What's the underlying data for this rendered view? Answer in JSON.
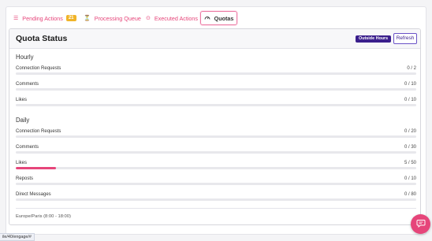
{
  "tabs": [
    {
      "label": "Pending Actions",
      "badge": "21",
      "icon": "list-icon"
    },
    {
      "label": "Processing Queue",
      "icon": "hourglass-icon"
    },
    {
      "label": "Executed Actions",
      "icon": "check-circle-icon"
    },
    {
      "label": "Quotas",
      "icon": "gauge-icon",
      "active": true
    }
  ],
  "panel": {
    "title": "Quota Status",
    "status_badge": "Outside Hours",
    "refresh_label": "Refresh"
  },
  "hourly": {
    "title": "Hourly",
    "rows": [
      {
        "label": "Connection Requests",
        "count": "0 / 2",
        "used": 0,
        "limit": 2
      },
      {
        "label": "Comments",
        "count": "0 / 10",
        "used": 0,
        "limit": 10
      },
      {
        "label": "Likes",
        "count": "0 / 10",
        "used": 0,
        "limit": 10
      }
    ]
  },
  "daily": {
    "title": "Daily",
    "rows": [
      {
        "label": "Connection Requests",
        "count": "0 / 20",
        "used": 0,
        "limit": 20
      },
      {
        "label": "Comments",
        "count": "0 / 30",
        "used": 0,
        "limit": 30
      },
      {
        "label": "Likes",
        "count": "5 / 50",
        "used": 5,
        "limit": 50
      },
      {
        "label": "Reposts",
        "count": "0 / 10",
        "used": 0,
        "limit": 10
      },
      {
        "label": "Direct Messages",
        "count": "0 / 80",
        "used": 0,
        "limit": 80
      }
    ]
  },
  "timezone": "Europe/Paris (8:00 - 18:00)",
  "url_fragment": "ile/40/engage/#",
  "colors": {
    "accent": "#e6457a",
    "badge_bg": "#3a1e8c",
    "pending_badge": "#f0b429"
  }
}
